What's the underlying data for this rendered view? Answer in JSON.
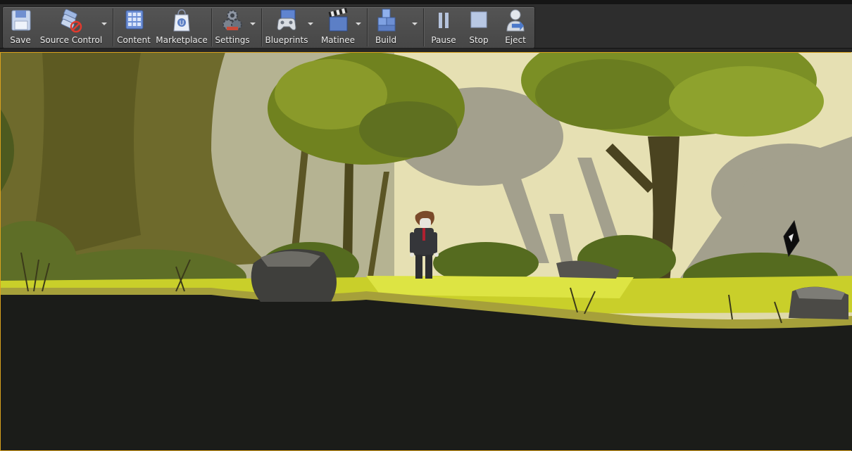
{
  "toolbar": {
    "buttons": [
      {
        "id": "save",
        "label": "Save",
        "icon": "floppy-disk-icon"
      },
      {
        "id": "source_control",
        "label": "Source Control",
        "icon": "source-control-disabled-icon",
        "has_dropdown": true
      },
      {
        "id": "content",
        "label": "Content",
        "icon": "content-browser-icon"
      },
      {
        "id": "marketplace",
        "label": "Marketplace",
        "icon": "marketplace-bag-icon"
      },
      {
        "id": "settings",
        "label": "Settings",
        "icon": "settings-gears-icon",
        "has_dropdown": true
      },
      {
        "id": "blueprints",
        "label": "Blueprints",
        "icon": "blueprints-gamepad-icon",
        "has_dropdown": true
      },
      {
        "id": "matinee",
        "label": "Matinee",
        "icon": "clapperboard-icon",
        "has_dropdown": true
      },
      {
        "id": "build",
        "label": "Build",
        "icon": "build-blocks-icon",
        "has_dropdown": true
      },
      {
        "id": "pause",
        "label": "Pause",
        "icon": "pause-icon"
      },
      {
        "id": "stop",
        "label": "Stop",
        "icon": "stop-icon"
      },
      {
        "id": "eject",
        "label": "Eject",
        "icon": "eject-user-icon"
      }
    ]
  },
  "viewport": {
    "mode": "play-in-editor",
    "scene": "2D side-scroller forest level",
    "border_color": "#d9a11e"
  },
  "colors": {
    "toolbar_bg": "#4d4d4d",
    "label": "#ececec",
    "sky": "#e9e2b4",
    "ground": "#1b1c19",
    "grass": "#c9cf2a"
  }
}
